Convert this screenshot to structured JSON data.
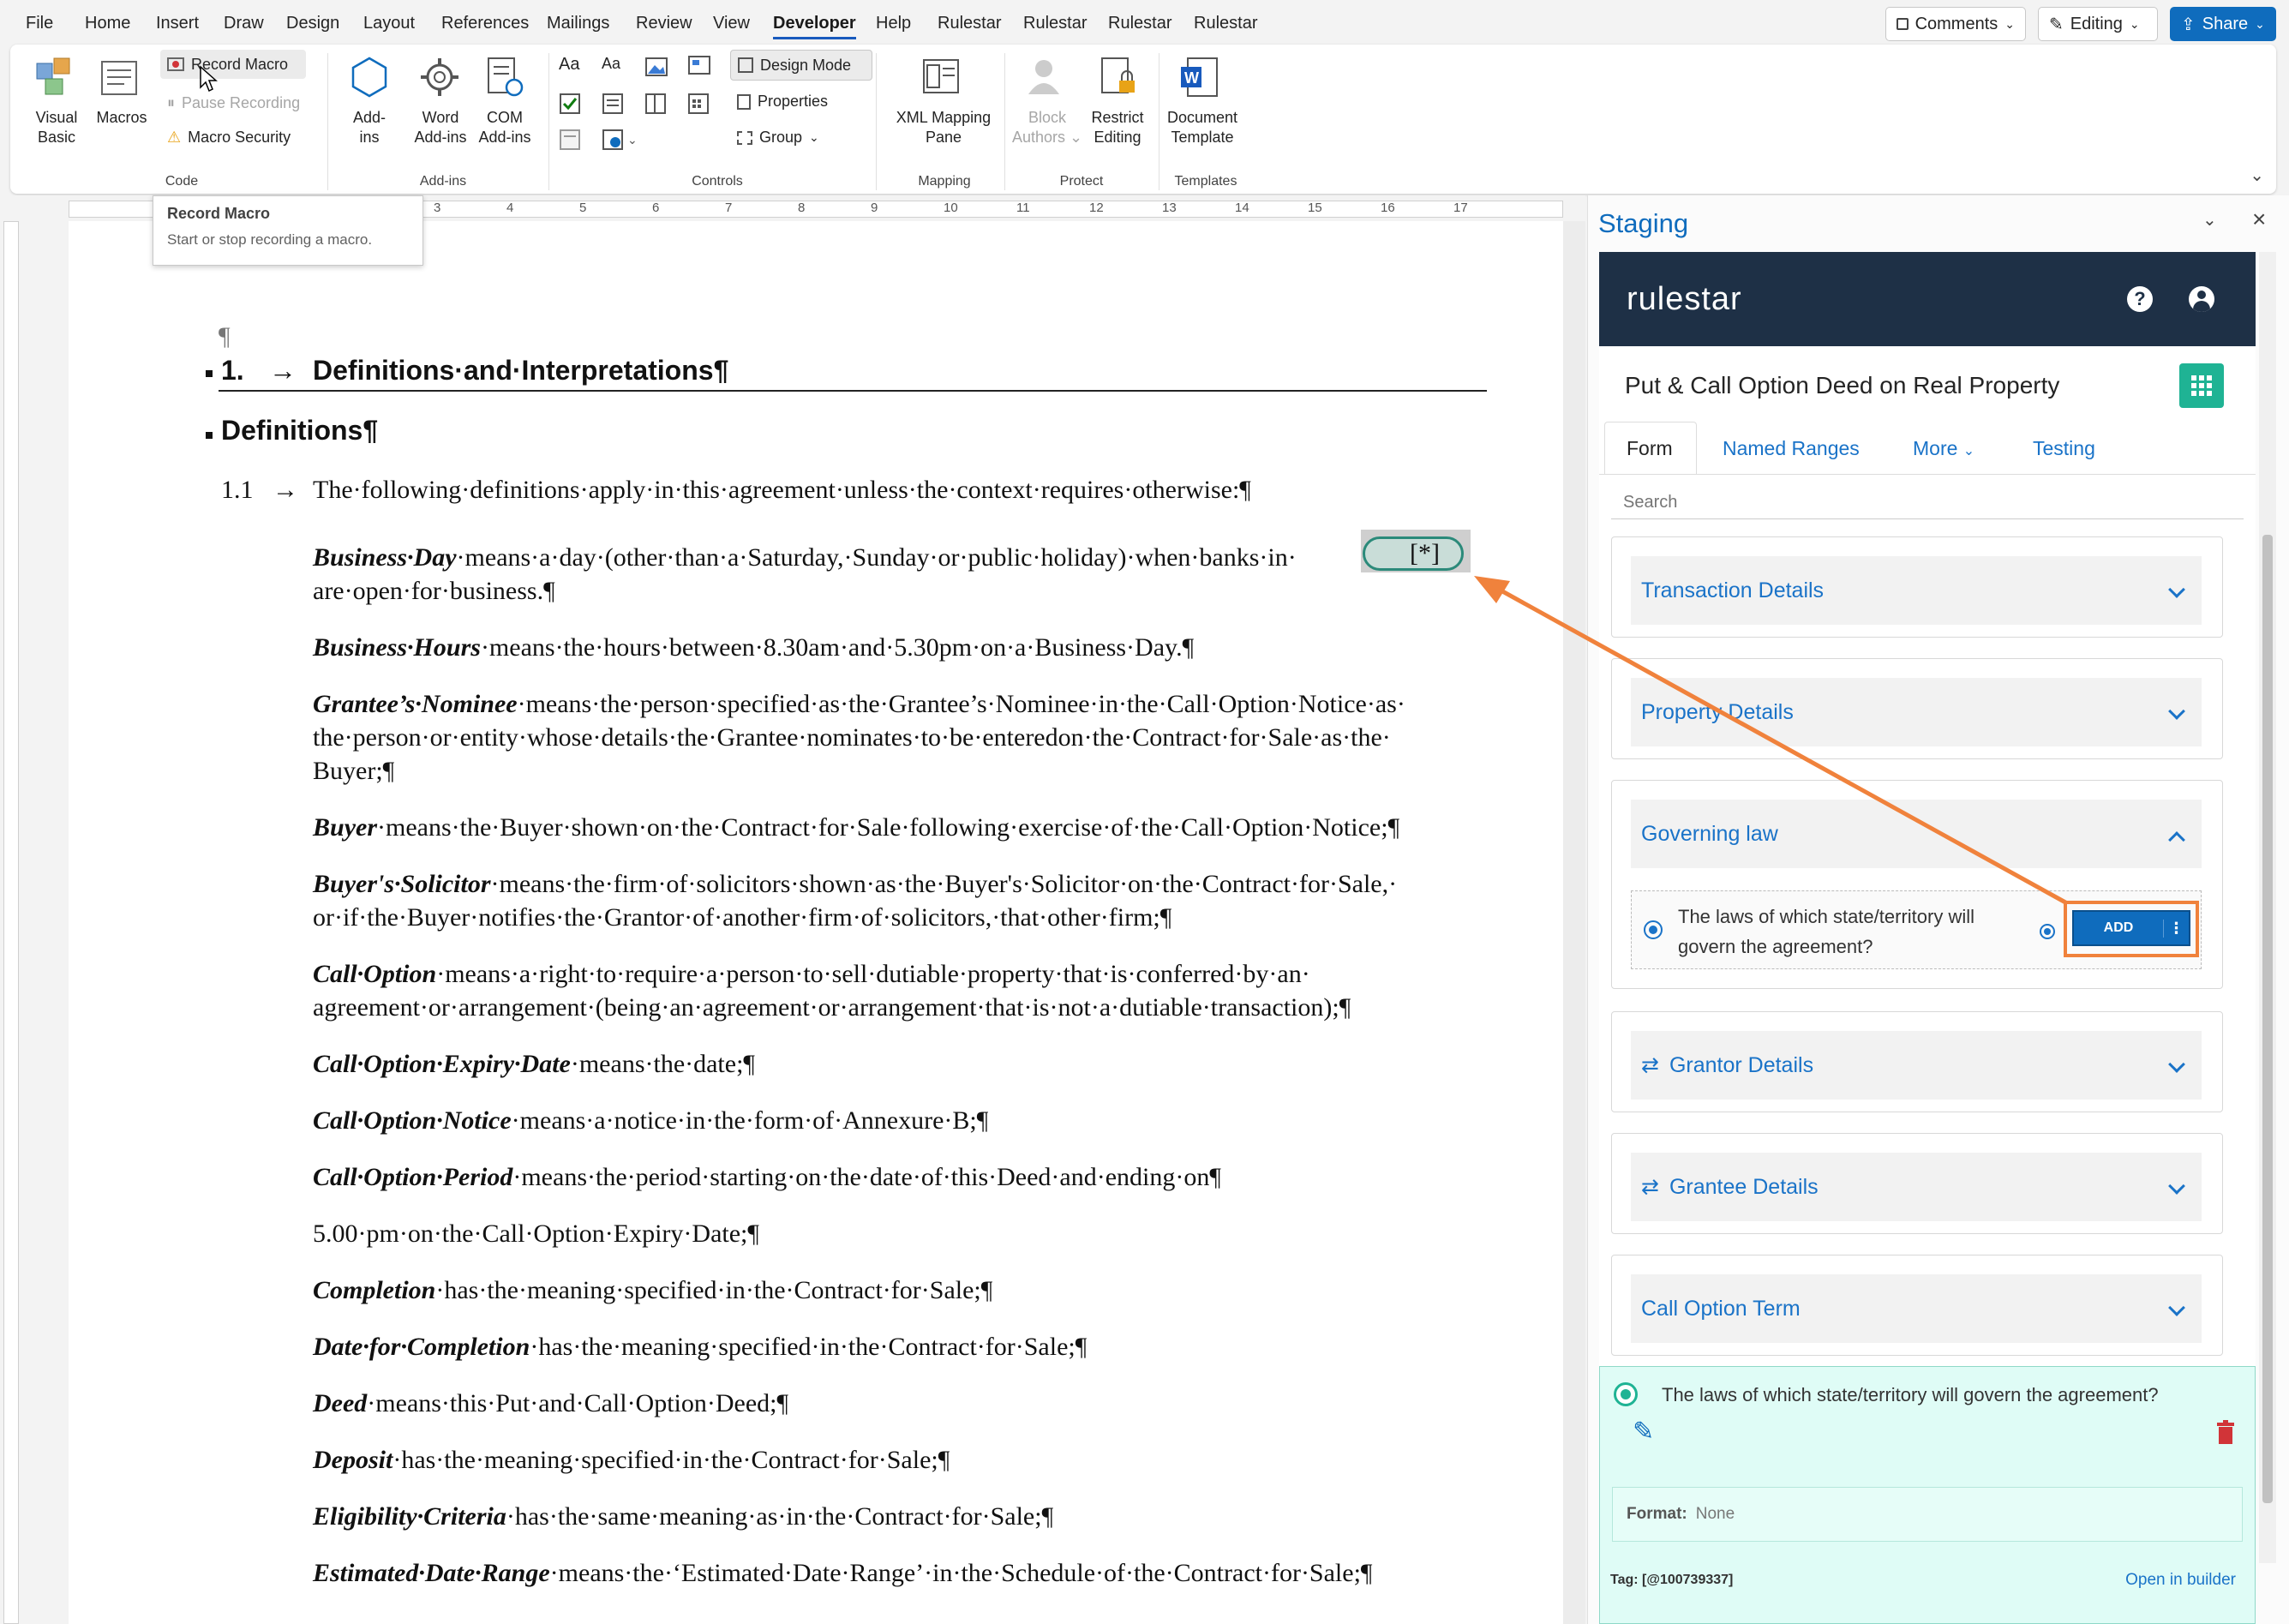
{
  "menubar": {
    "tabs": [
      "File",
      "Home",
      "Insert",
      "Draw",
      "Design",
      "Layout",
      "References",
      "Mailings",
      "Review",
      "View",
      "Developer",
      "Help",
      "Rulestar",
      "Rulestar",
      "Rulestar",
      "Rulestar"
    ],
    "active": "Developer",
    "comments": "Comments",
    "editing": "Editing",
    "share": "Share"
  },
  "ribbon": {
    "code": {
      "visual_basic": "Visual Basic",
      "macros": "Macros",
      "record_macro": "Record Macro",
      "pause_recording": "Pause Recording",
      "macro_security": "Macro Security",
      "label": "Code"
    },
    "addins": {
      "addins": "Add-ins",
      "word_addins": "Word Add-ins",
      "com_addins": "COM Add-ins",
      "label": "Add-ins"
    },
    "controls": {
      "design_mode": "Design Mode",
      "properties": "Properties",
      "group": "Group",
      "label": "Controls"
    },
    "mapping": {
      "xml_pane": "XML Mapping Pane",
      "label": "Mapping"
    },
    "protect": {
      "block_authors": "Block Authors",
      "restrict_editing": "Restrict Editing",
      "label": "Protect"
    },
    "templates": {
      "document_template": "Document Template",
      "label": "Templates"
    }
  },
  "tooltip": {
    "title": "Record Macro",
    "text": "Start or stop recording a macro."
  },
  "ruler": {
    "ticks": [
      "3",
      "4",
      "5",
      "6",
      "7",
      "8",
      "9",
      "10",
      "11",
      "12",
      "13",
      "14",
      "15",
      "16",
      "17"
    ]
  },
  "doc": {
    "pilcrow": "¶",
    "heading1_num": "1.",
    "heading1_arrow": "→",
    "heading1": "Definitions·and·Interpretations¶",
    "heading2": "Definitions¶",
    "clause_num": "1.1",
    "clause_arrow": "→",
    "clause_text": "The·following·definitions·apply·in·this·agreement·unless·the·context·requires·otherwise:¶",
    "content_control": "[*]",
    "entries": [
      {
        "term": "Business·Day",
        "l1": "·means·a·day·(other·than·a·Saturday,·Sunday·or·public·holiday)·when·banks·in·",
        "l2": "are·open·for·business.¶"
      },
      {
        "term": "Business·Hours",
        "l1": "·means·the·hours·between·8.30am·and·5.30pm·on·a·Business·Day.¶"
      },
      {
        "term": "Grantee’s·Nominee",
        "l1": "·means·the·person·specified·as·the·Grantee’s·Nominee·in·the·Call·Option·Notice·as·",
        "l2": "the·person·or·entity·whose·details·the·Grantee·nominates·to·be·enteredon·the·Contract·for·Sale·as·the·",
        "l3": "Buyer;¶"
      },
      {
        "term": "Buyer",
        "l1": "·means·the·Buyer·shown·on·the·Contract·for·Sale·following·exercise·of·the·Call·Option·Notice;¶"
      },
      {
        "term": "Buyer's·Solicitor",
        "l1": "·means·the·firm·of·solicitors·shown·as·the·Buyer's·Solicitor·on·the·Contract·for·Sale,·",
        "l2": "or·if·the·Buyer·notifies·the·Grantor·of·another·firm·of·solicitors,·that·other·firm;¶"
      },
      {
        "term": "Call·Option",
        "l1": "·means·a·right·to·require·a·person·to·sell·dutiable·property·that·is·conferred·by·an·",
        "l2": "agreement·or·arrangement·(being·an·agreement·or·arrangement·that·is·not·a·dutiable·transaction);¶"
      },
      {
        "term": "Call·Option·Expiry·Date",
        "l1": "·means·the·date;¶"
      },
      {
        "term": "Call·Option·Notice",
        "l1": "·means·a·notice·in·the·form·of·Annexure·B;¶"
      },
      {
        "term": "Call·Option·Period",
        "l1": "·means·the·period·starting·on·the·date·of·this·Deed·and·ending·on¶"
      },
      {
        "term": "",
        "l1": "5.00·pm·on·the·Call·Option·Expiry·Date;¶"
      },
      {
        "term": "Completion",
        "l1": "·has·the·meaning·specified·in·the·Contract·for·Sale;¶"
      },
      {
        "term": "Date·for·Completion",
        "l1": "·has·the·meaning·specified·in·the·Contract·for·Sale;¶"
      },
      {
        "term": "Deed",
        "l1": "·means·this·Put·and·Call·Option·Deed;¶"
      },
      {
        "term": "Deposit",
        "l1": "·has·the·meaning·specified·in·the·Contract·for·Sale;¶"
      },
      {
        "term": "Eligibility·Criteria",
        "l1": "·has·the·same·meaning·as·in·the·Contract·for·Sale;¶"
      },
      {
        "term": "Estimated·Date·Range",
        "l1": "·means·the·‘Estimated·Date·Range’·in·the·Schedule·of·the·Contract·for·Sale;¶"
      }
    ]
  },
  "pane": {
    "title": "Staging",
    "logo": "rulestar",
    "doc_title": "Put & Call Option Deed on Real Property",
    "tabs": [
      "Form",
      "Named Ranges",
      "More",
      "Testing"
    ],
    "search_placeholder": "Search",
    "sections": [
      "Transaction Details",
      "Property Details",
      "Governing law",
      "Grantor Details",
      "Grantee Details",
      "Call Option Term"
    ],
    "question": "The laws of which state/territory will govern the agreement?",
    "question_l1": "The laws of which state/territory will",
    "question_l2": "govern the agreement?",
    "add": "ADD",
    "format_label": "Format:",
    "format_value": "None",
    "tag": "Tag: [@100739337]",
    "open_builder": "Open in builder"
  },
  "colors": {
    "accent": "#0f6cbd",
    "annotation": "#f0823c",
    "rulestar_navy": "#1e3046",
    "teal": "#1fb394"
  }
}
